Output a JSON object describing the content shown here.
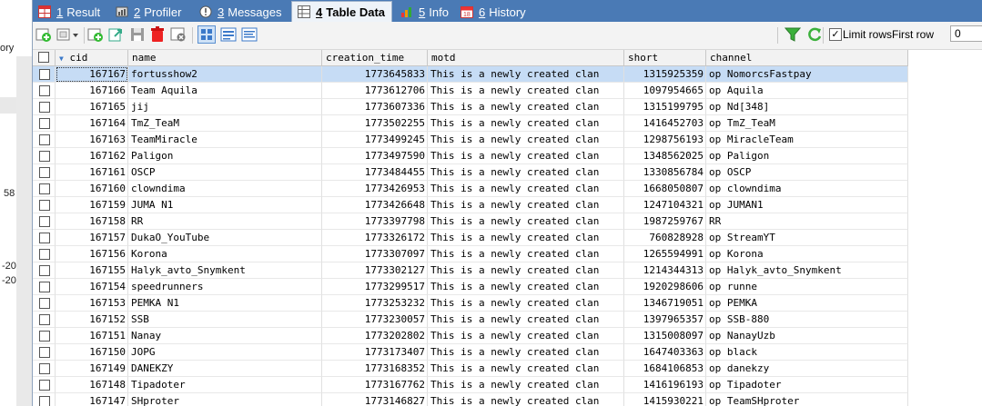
{
  "left_fragments": [
    "ory",
    "58",
    "-20",
    "-20"
  ],
  "tabs": [
    {
      "num": "1",
      "label": "Result",
      "icon": "grid-icon"
    },
    {
      "num": "2",
      "label": "Profiler",
      "icon": "profiler-icon"
    },
    {
      "num": "3",
      "label": "Messages",
      "icon": "messages-icon"
    },
    {
      "num": "4",
      "label": "Table Data",
      "icon": "table-icon",
      "active": true
    },
    {
      "num": "5",
      "label": "Info",
      "icon": "info-icon"
    },
    {
      "num": "6",
      "label": "History",
      "icon": "calendar-icon"
    }
  ],
  "toolbar": {
    "limit_rows_label": "Limit rows",
    "limit_rows_checked": true,
    "first_row_label": "First row",
    "first_row_value": "0",
    "icons": [
      "add-row-icon",
      "duplicate-row-icon",
      "insert-row-icon",
      "export-icon",
      "save-icon",
      "delete-icon",
      "reset-icon",
      "grid-view-icon",
      "form-view-icon",
      "text-view-icon",
      "filter-icon",
      "refresh-icon"
    ]
  },
  "table": {
    "columns": [
      "cid",
      "name",
      "creation_time",
      "motd",
      "short",
      "channel"
    ],
    "sorted_column": "cid",
    "rows": [
      [
        "167167",
        "fortusshow2",
        "1773645833",
        "This is a newly created clan",
        "1315925359",
        "op NomorcsFastpay"
      ],
      [
        "167166",
        "Team Aquila",
        "1773612706",
        "This is a newly created clan",
        "1097954665",
        "op Aquila"
      ],
      [
        "167165",
        "jij",
        "1773607336",
        "This is a newly created clan",
        "1315199795",
        "op Nd[348]"
      ],
      [
        "167164",
        "TmZ_TeaM",
        "1773502255",
        "This is a newly created clan",
        "1416452703",
        "op TmZ_TeaM"
      ],
      [
        "167163",
        "TeamMiracle",
        "1773499245",
        "This is a newly created clan",
        "1298756193",
        "op MiracleTeam"
      ],
      [
        "167162",
        "Paligon",
        "1773497590",
        "This is a newly created clan",
        "1348562025",
        "op Paligon"
      ],
      [
        "167161",
        "OSCP",
        "1773484455",
        "This is a newly created clan",
        "1330856784",
        "op OSCP"
      ],
      [
        "167160",
        "clowndima",
        "1773426953",
        "This is a newly created clan",
        "1668050807",
        "op clowndima"
      ],
      [
        "167159",
        "JUMA N1",
        "1773426648",
        "This is a newly created clan",
        "1247104321",
        "op JUMAN1"
      ],
      [
        "167158",
        "RR",
        "1773397798",
        "This is a newly created clan",
        "1987259767",
        "RR"
      ],
      [
        "167157",
        "DukaO_YouTube",
        "1773326172",
        "This is a newly created clan",
        "760828928",
        "op StreamYT"
      ],
      [
        "167156",
        "Korona",
        "1773307097",
        "This is a newly created clan",
        "1265594991",
        "op Korona"
      ],
      [
        "167155",
        "Halyk_avto_Snymkent",
        "1773302127",
        "This is a newly created clan",
        "1214344313",
        "op Halyk_avto_Snymkent"
      ],
      [
        "167154",
        "speedrunners",
        "1773299517",
        "This is a newly created clan",
        "1920298606",
        "op runne"
      ],
      [
        "167153",
        "PEMKA N1",
        "1773253232",
        "This is a newly created clan",
        "1346719051",
        "op PEMKA"
      ],
      [
        "167152",
        "SSB",
        "1773230057",
        "This is a newly created clan",
        "1397965357",
        "op SSB-880"
      ],
      [
        "167151",
        "Nanay",
        "1773202802",
        "This is a newly created clan",
        "1315008097",
        "op NanayUzb"
      ],
      [
        "167150",
        "JOPG",
        "1773173407",
        "This is a newly created clan",
        "1647403363",
        "op black"
      ],
      [
        "167149",
        "DANEKZY",
        "1773168352",
        "This is a newly created clan",
        "1684106853",
        "op danekzy"
      ],
      [
        "167148",
        "Tipadoter",
        "1773167762",
        "This is a newly created clan",
        "1416196193",
        "op Tipadoter"
      ],
      [
        "167147",
        "SHproter",
        "1773146827",
        "This is a newly created clan",
        "1415930221",
        "op TeamSHproter"
      ]
    ]
  }
}
